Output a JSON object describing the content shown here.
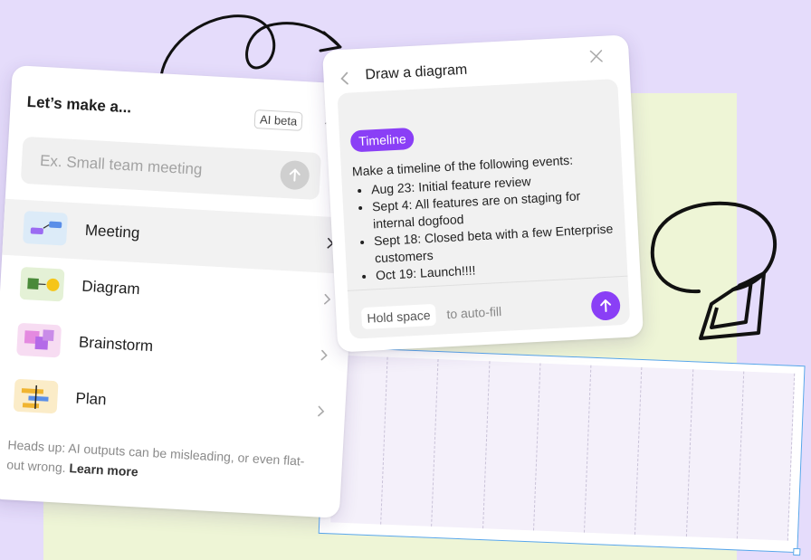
{
  "left_panel": {
    "title": "Let’s make a...",
    "badge": "AI beta",
    "prompt_placeholder": "Ex. Small team meeting",
    "items": [
      {
        "label": "Meeting",
        "icon": "meeting-template-icon"
      },
      {
        "label": "Diagram",
        "icon": "diagram-template-icon"
      },
      {
        "label": "Brainstorm",
        "icon": "brainstorm-template-icon"
      },
      {
        "label": "Plan",
        "icon": "plan-template-icon"
      }
    ],
    "footer_text": "Heads up: AI outputs can be misleading, or even flat-out wrong.",
    "learn_more": "Learn more"
  },
  "right_panel": {
    "title": "Draw a diagram",
    "tag": "Timeline",
    "intro": "Make a timeline of the following events:",
    "bullets": [
      "Aug 23: Initial feature review",
      "Sept 4: All features are on staging for internal dogfood",
      "Sept 18:  Closed beta with a few Enterprise customers",
      "Oct 19: Launch!!!!"
    ],
    "hold_key": "Hold space",
    "autofill": "to auto-fill"
  },
  "colors": {
    "background": "#e5dcfb",
    "board": "#eef5d6",
    "accent": "#8a3ff6",
    "selection": "#58a6ea"
  }
}
